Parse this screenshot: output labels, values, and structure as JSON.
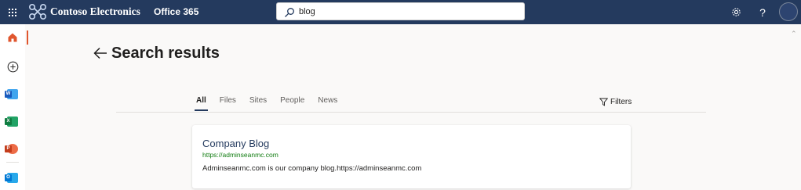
{
  "header": {
    "brand": "Contoso Electronics",
    "app_name": "Office 365",
    "search_value": "blog",
    "help_label": "?"
  },
  "rail": {
    "items": [
      {
        "name": "Home",
        "icon": "home-icon",
        "active": true
      },
      {
        "name": "Create",
        "icon": "plus-circle-icon"
      },
      {
        "name": "Word",
        "icon": "word-icon",
        "letter": "W",
        "color": "#185abd"
      },
      {
        "name": "Excel",
        "icon": "excel-icon",
        "letter": "X",
        "color": "#107c41"
      },
      {
        "name": "PowerPoint",
        "icon": "powerpoint-icon",
        "letter": "P",
        "color": "#c43e1c"
      },
      {
        "name": "Outlook",
        "icon": "outlook-icon",
        "letter": "O",
        "color": "#0078d4"
      }
    ]
  },
  "page": {
    "title": "Search results"
  },
  "tabs": [
    {
      "label": "All",
      "active": true
    },
    {
      "label": "Files"
    },
    {
      "label": "Sites"
    },
    {
      "label": "People"
    },
    {
      "label": "News"
    }
  ],
  "filters_label": "Filters",
  "results": [
    {
      "title": "Company Blog",
      "url": "https://adminseanmc.com",
      "description": "Adminseanmc.com is our company blog.https://adminseanmc.com"
    }
  ],
  "colors": {
    "header_bg": "#243a5e",
    "accent": "#e0562e",
    "link": "#243a5e",
    "url_green": "#107c10"
  }
}
